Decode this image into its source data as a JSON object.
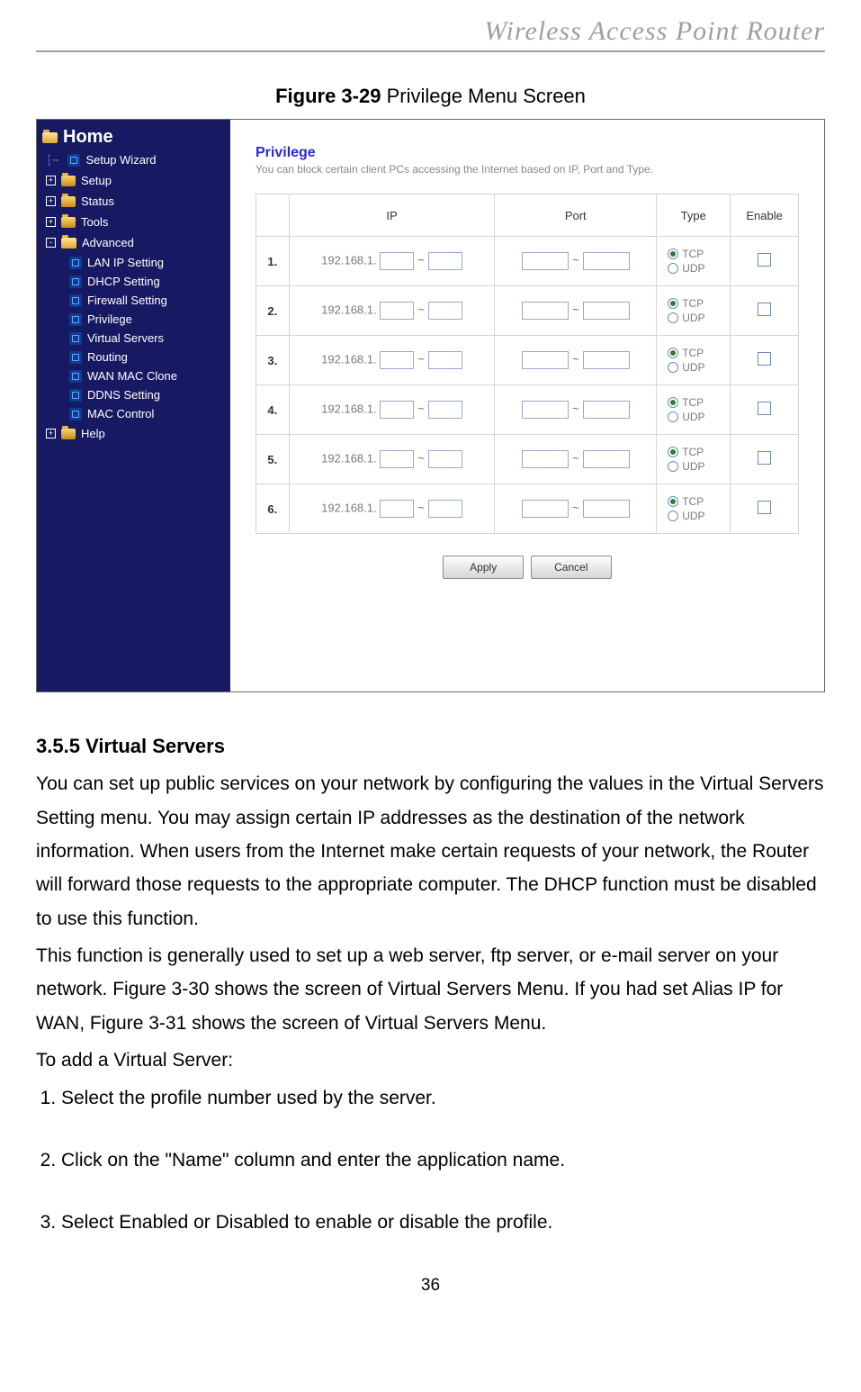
{
  "document": {
    "header_title": "Wireless Access Point Router",
    "page_number": "36",
    "figure_caption_bold": "Figure 3-29",
    "figure_caption_rest": " Privilege Menu Screen",
    "section_heading": "3.5.5 Virtual Servers",
    "para1": "You can set up public services on your network by configuring the values in the Virtual Servers Setting menu. You may assign certain IP addresses as the destination of the network information. When users from the Internet make certain requests of your network, the Router will forward those requests to the appropriate computer. The DHCP function must be disabled to use this function.",
    "para2": "This function is generally used to set up a web server, ftp server, or e-mail server on your network. Figure 3-30 shows the screen of Virtual Servers Menu. If you had set Alias IP for WAN, Figure 3-31 shows the screen of Virtual Servers Menu.",
    "para3": "To add a Virtual Server:",
    "steps": [
      "Select the profile number used by the server.",
      "Click on the \"Name\" column and enter the application name.",
      "Select Enabled or Disabled to enable or disable the profile."
    ]
  },
  "sidebar": {
    "root": "Home",
    "items": [
      {
        "label": "Setup Wizard",
        "type": "doc"
      },
      {
        "label": "Setup",
        "type": "folder",
        "box": "+"
      },
      {
        "label": "Status",
        "type": "folder",
        "box": "+"
      },
      {
        "label": "Tools",
        "type": "folder",
        "box": "+"
      },
      {
        "label": "Advanced",
        "type": "folder-open",
        "box": "-",
        "children": [
          "LAN IP Setting",
          "DHCP Setting",
          "Firewall Setting",
          "Privilege",
          "Virtual Servers",
          "Routing",
          "WAN MAC Clone",
          "DDNS Setting",
          "MAC Control"
        ]
      },
      {
        "label": "Help",
        "type": "folder",
        "box": "+"
      }
    ]
  },
  "pane": {
    "title": "Privilege",
    "desc": "You can block certain client PCs accessing the Internet based on IP, Port and Type.",
    "columns": {
      "ip": "IP",
      "port": "Port",
      "type": "Type",
      "enable": "Enable"
    },
    "ip_prefix": "192.168.1.",
    "rows": [
      "1.",
      "2.",
      "3.",
      "4.",
      "5.",
      "6."
    ],
    "types": {
      "tcp": "TCP",
      "udp": "UDP"
    },
    "buttons": {
      "apply": "Apply",
      "cancel": "Cancel"
    }
  }
}
